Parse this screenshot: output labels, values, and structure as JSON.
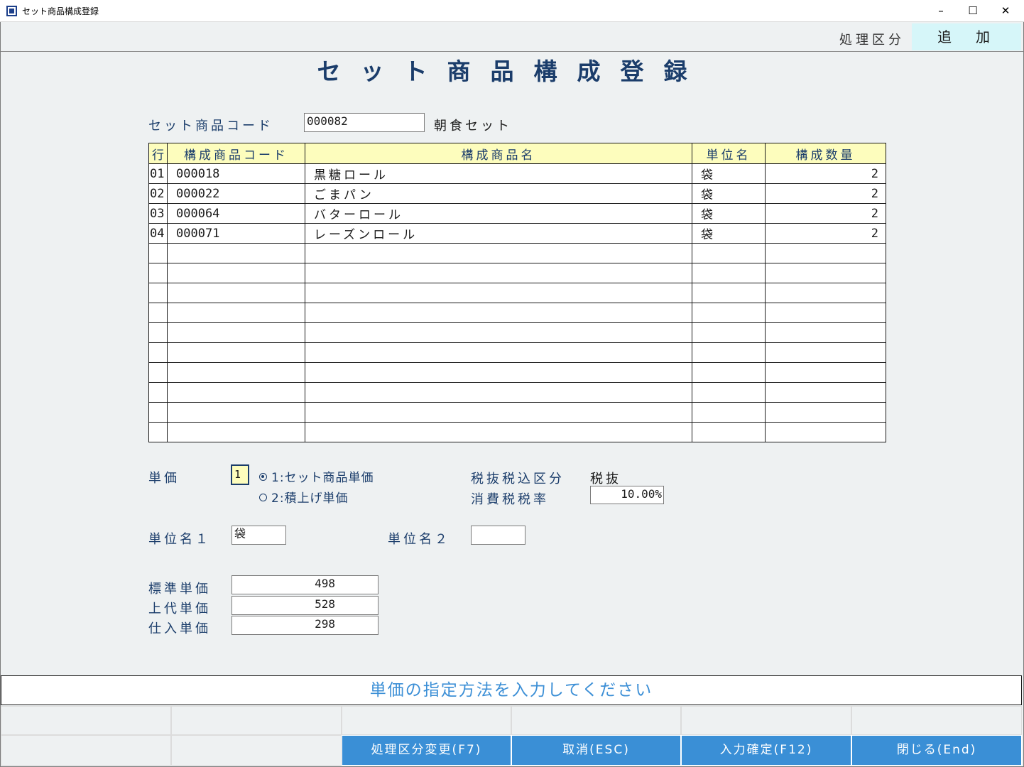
{
  "window": {
    "title": "セット商品構成登録",
    "minimize": "–",
    "maximize": "☐",
    "close": "✕"
  },
  "mode": {
    "label": "処理区分",
    "value": "追加"
  },
  "page_title": "セット商品構成登録",
  "set_product": {
    "label": "セット商品コード",
    "code": "000082",
    "name": "朝食セット"
  },
  "grid": {
    "headers": [
      "行",
      "構成商品コード",
      "構成商品名",
      "単位名",
      "構成数量"
    ],
    "rows": [
      {
        "row": "01",
        "code": "000018",
        "name": "黒糖ロール",
        "unit": "袋",
        "qty": "2"
      },
      {
        "row": "02",
        "code": "000022",
        "name": "ごまパン",
        "unit": "袋",
        "qty": "2"
      },
      {
        "row": "03",
        "code": "000064",
        "name": "バターロール",
        "unit": "袋",
        "qty": "2"
      },
      {
        "row": "04",
        "code": "000071",
        "name": "レーズンロール",
        "unit": "袋",
        "qty": "2"
      }
    ]
  },
  "unit_price": {
    "label": "単価",
    "selected": "1",
    "option1": "1:セット商品単価",
    "option2": "2:積上げ単価"
  },
  "tax": {
    "type_label": "税抜税込区分",
    "type_value": "税抜",
    "rate_label": "消費税税率",
    "rate_value": "10.00%"
  },
  "unit_names": {
    "unit1_label": "単位名１",
    "unit1_value": "袋",
    "unit2_label": "単位名２",
    "unit2_value": ""
  },
  "prices": {
    "standard_label": "標準単価",
    "standard_value": "498",
    "retail_label": "上代単価",
    "retail_value": "528",
    "purchase_label": "仕入単価",
    "purchase_value": "298"
  },
  "message": "単価の指定方法を入力してください",
  "function_keys": {
    "f7": "処理区分変更(F7)",
    "esc": "取消(ESC)",
    "f12": "入力確定(F12)",
    "end": "閉じる(End)"
  }
}
